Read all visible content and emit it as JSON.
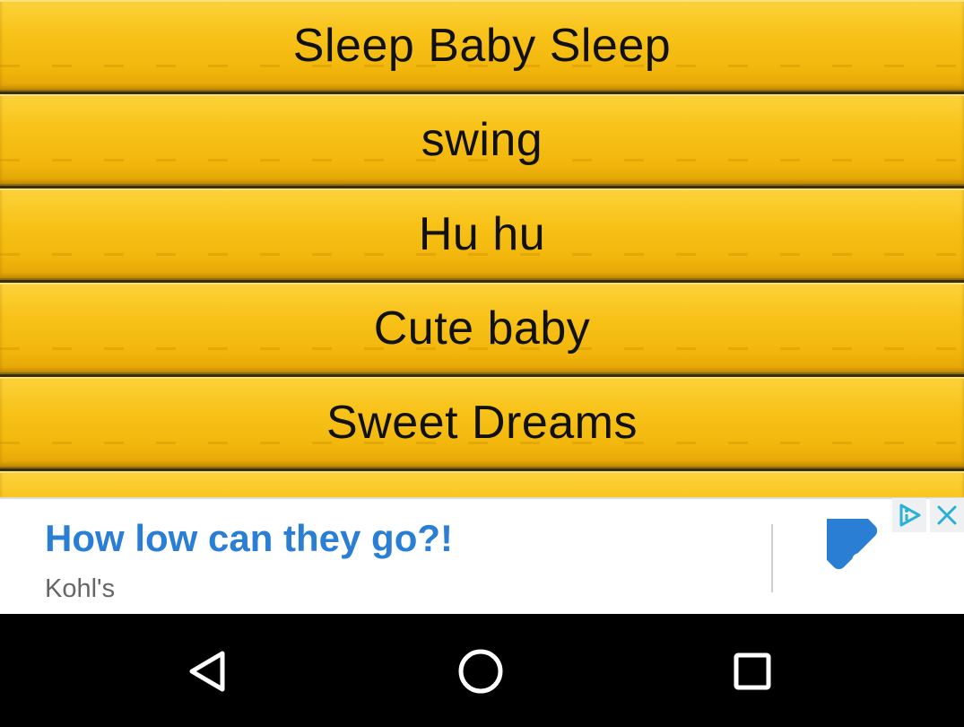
{
  "songs": [
    {
      "label": "Sleep Baby Sleep"
    },
    {
      "label": "swing"
    },
    {
      "label": "Hu hu"
    },
    {
      "label": "Cute baby"
    },
    {
      "label": "Sweet Dreams"
    },
    {
      "label": ""
    }
  ],
  "ad": {
    "headline": "How low can they go?!",
    "advertiser": "Kohl's",
    "cta_icon": "share-arrow-icon",
    "adchoices_icon": "adchoices-icon",
    "close_icon": "close-icon",
    "accent_color": "#2a7fd4"
  },
  "navbar": {
    "back_icon": "back-triangle-icon",
    "home_icon": "home-circle-icon",
    "recents_icon": "recents-square-icon"
  },
  "colors": {
    "item_bg": "#f8c31a",
    "item_text": "#111111",
    "navbar_bg": "#000000"
  }
}
